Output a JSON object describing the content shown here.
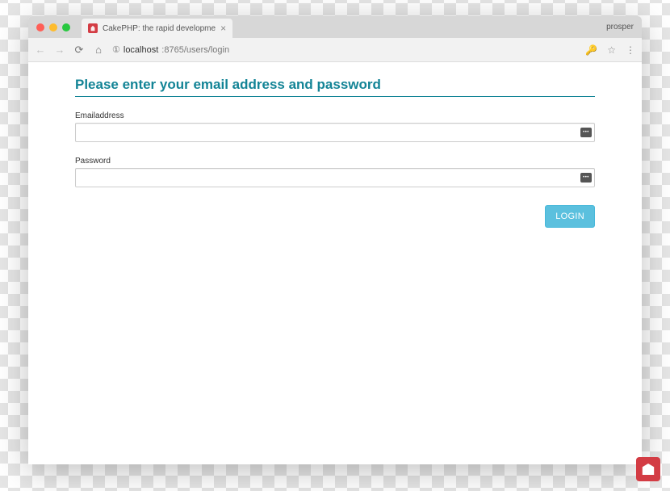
{
  "browser": {
    "tab_title": "CakePHP: the rapid developme",
    "profile": "prosper",
    "url": {
      "prefix": "①",
      "host": "localhost",
      "port_path": ":8765/users/login"
    }
  },
  "page": {
    "heading": "Please enter your email address and password",
    "email_label": "Emailaddress",
    "email_value": "",
    "password_label": "Password",
    "password_value": "",
    "login_button": "LOGIN"
  }
}
